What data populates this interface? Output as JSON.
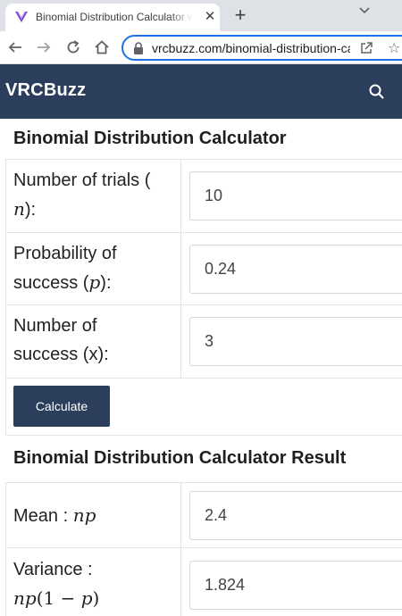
{
  "browser": {
    "tab_title": "Binomial Distribution Calculator with",
    "close_glyph": "✕",
    "new_tab_glyph": "+",
    "url": "vrcbuzz.com/binomial-distribution-calculator",
    "accent": "#1a73e8",
    "icons": [
      "vrcbuzz-favicon",
      "tab-search-icon",
      "back-icon",
      "forward-icon",
      "reload-icon",
      "home-icon",
      "lock-icon",
      "share-icon",
      "star-icon"
    ]
  },
  "site": {
    "brand": "VRCBuzz",
    "header_color": "#2b3f5c",
    "search_icon": "search-icon"
  },
  "calculator": {
    "title": "Binomial Distribution Calculator",
    "trials": {
      "label_text": "Number of trials (",
      "label_var": "n",
      "label_end": "):",
      "value": "10"
    },
    "probability": {
      "label_line1": "Probability of",
      "label_line2": "success (",
      "label_var": "p",
      "label_end": "):",
      "value": "0.24"
    },
    "successes": {
      "label_line1": "Number of",
      "label_line2": "success (x):",
      "value": "3"
    },
    "button_label": "Calculate"
  },
  "result": {
    "title": "Binomial Distribution Calculator Result",
    "mean": {
      "label_text": "Mean : ",
      "label_formula": "np",
      "value": "2.4"
    },
    "variance": {
      "label_text": "Variance :",
      "f_n": "n",
      "f_p": "p",
      "f_open": "(",
      "f_one": "1",
      "f_minus": " − ",
      "f_p2": "p",
      "f_close": ")",
      "value": "1.824"
    }
  }
}
